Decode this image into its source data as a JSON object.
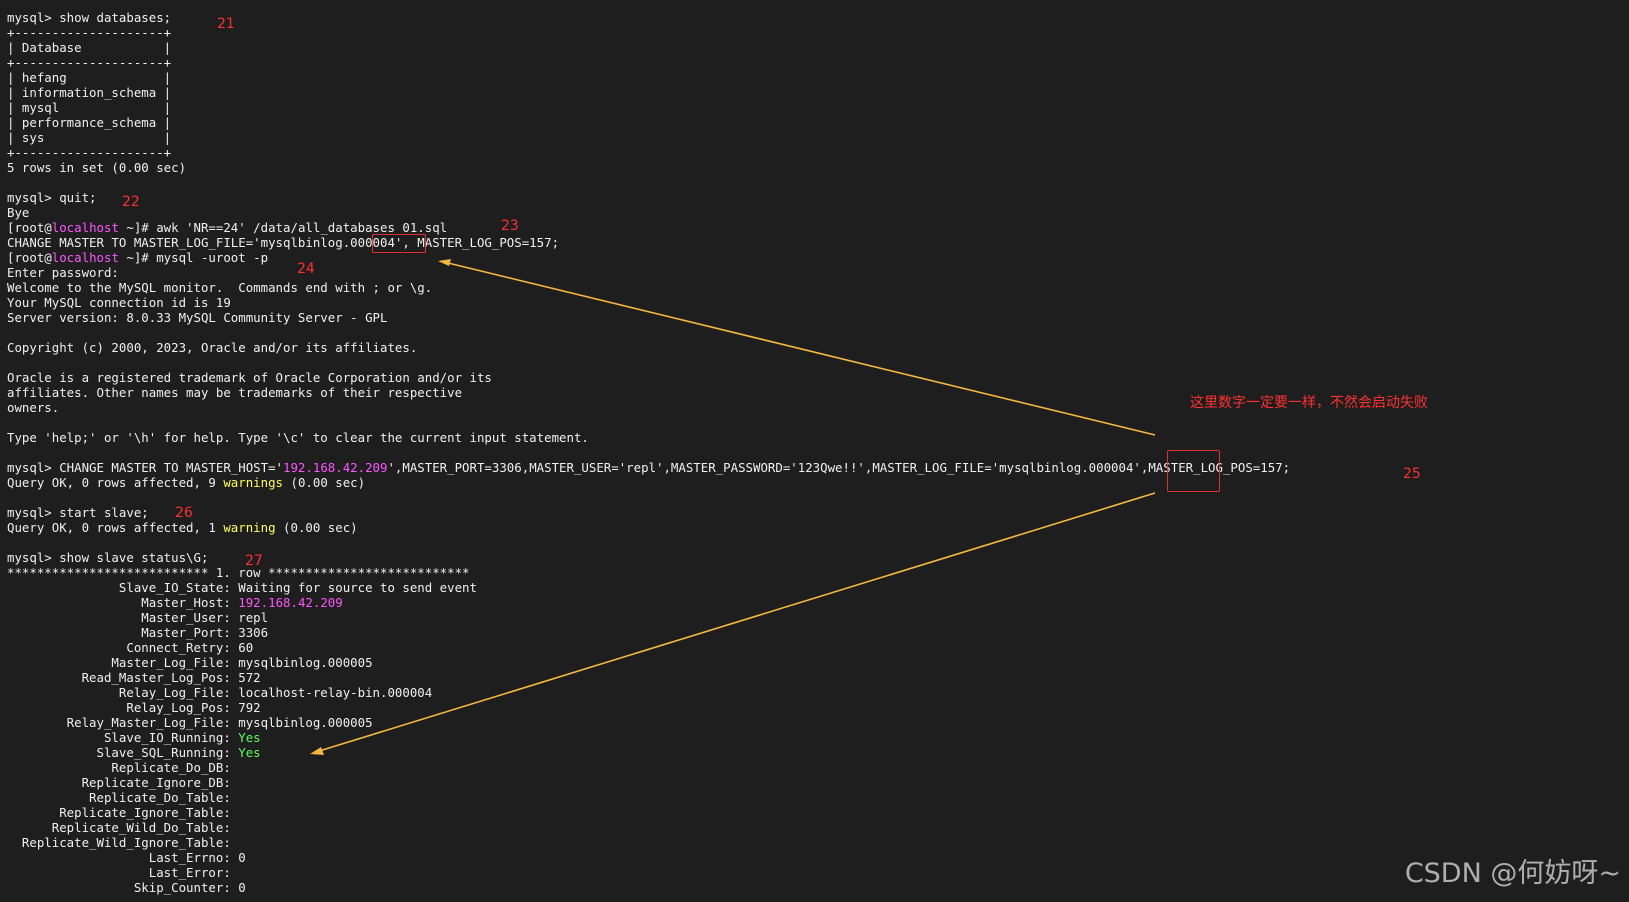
{
  "terminal": {
    "lines": [
      "mysql> show databases;",
      "+--------------------+",
      "| Database           |",
      "+--------------------+",
      "| hefang             |",
      "| information_schema |",
      "| mysql              |",
      "| performance_schema |",
      "| sys                |",
      "+--------------------+",
      "5 rows in set (0.00 sec)",
      "",
      "mysql> quit;",
      "Bye",
      "[root@localhost ~]# awk 'NR==24' /data/all_databases_01.sql",
      "CHANGE MASTER TO MASTER_LOG_FILE='mysqlbinlog.000004', MASTER_LOG_POS=157;",
      "[root@localhost ~]# mysql -uroot -p",
      "Enter password:",
      "Welcome to the MySQL monitor.  Commands end with ; or \\g.",
      "Your MySQL connection id is 19",
      "Server version: 8.0.33 MySQL Community Server - GPL",
      "",
      "Copyright (c) 2000, 2023, Oracle and/or its affiliates.",
      "",
      "Oracle is a registered trademark of Oracle Corporation and/or its",
      "affiliates. Other names may be trademarks of their respective",
      "owners.",
      "",
      "Type 'help;' or '\\h' for help. Type '\\c' to clear the current input statement.",
      "",
      "mysql> CHANGE MASTER TO MASTER_HOST='192.168.42.209',MASTER_PORT=3306,MASTER_USER='repl',MASTER_PASSWORD='123Qwe!!',MASTER_LOG_FILE='mysqlbinlog.000004',MASTER_LOG_POS=157;",
      "Query OK, 0 rows affected, 9 warnings (0.00 sec)",
      "",
      "mysql> start slave;",
      "Query OK, 0 rows affected, 1 warning (0.00 sec)",
      "",
      "mysql> show slave status\\G;",
      "*************************** 1. row ***************************",
      "               Slave_IO_State: Waiting for source to send event",
      "                  Master_Host: 192.168.42.209",
      "                  Master_User: repl",
      "                  Master_Port: 3306",
      "                Connect_Retry: 60",
      "              Master_Log_File: mysqlbinlog.000005",
      "          Read_Master_Log_Pos: 572",
      "               Relay_Log_File: localhost-relay-bin.000004",
      "                Relay_Log_Pos: 792",
      "        Relay_Master_Log_File: mysqlbinlog.000005",
      "             Slave_IO_Running: Yes",
      "            Slave_SQL_Running: Yes",
      "              Replicate_Do_DB:",
      "          Replicate_Ignore_DB:",
      "           Replicate_Do_Table:",
      "       Replicate_Ignore_Table:",
      "      Replicate_Wild_Do_Table:",
      "  Replicate_Wild_Ignore_Table:",
      "                   Last_Errno: 0",
      "                   Last_Error:",
      "                 Skip_Counter: 0"
    ],
    "highlights": {
      "host_word": "localhost",
      "ip": "192.168.42.209",
      "warning_words": [
        "warnings",
        "warning"
      ],
      "yes_word": "Yes"
    }
  },
  "annotations": {
    "n21": "21",
    "n22": "22",
    "n23": "23",
    "n24": "24",
    "n25": "25",
    "n26": "26",
    "n27": "27",
    "note": "这里数字一定要一样，不然会启动失败"
  },
  "watermark": "CSDN @何妨呀~",
  "colors": {
    "background": "#1e1e1e",
    "text": "#f0f0f0",
    "magenta": "#ff55ff",
    "yellow": "#ffff55",
    "green": "#55ff55",
    "annotation_red": "#ff3030",
    "arrow_orange": "#f5b83d"
  }
}
